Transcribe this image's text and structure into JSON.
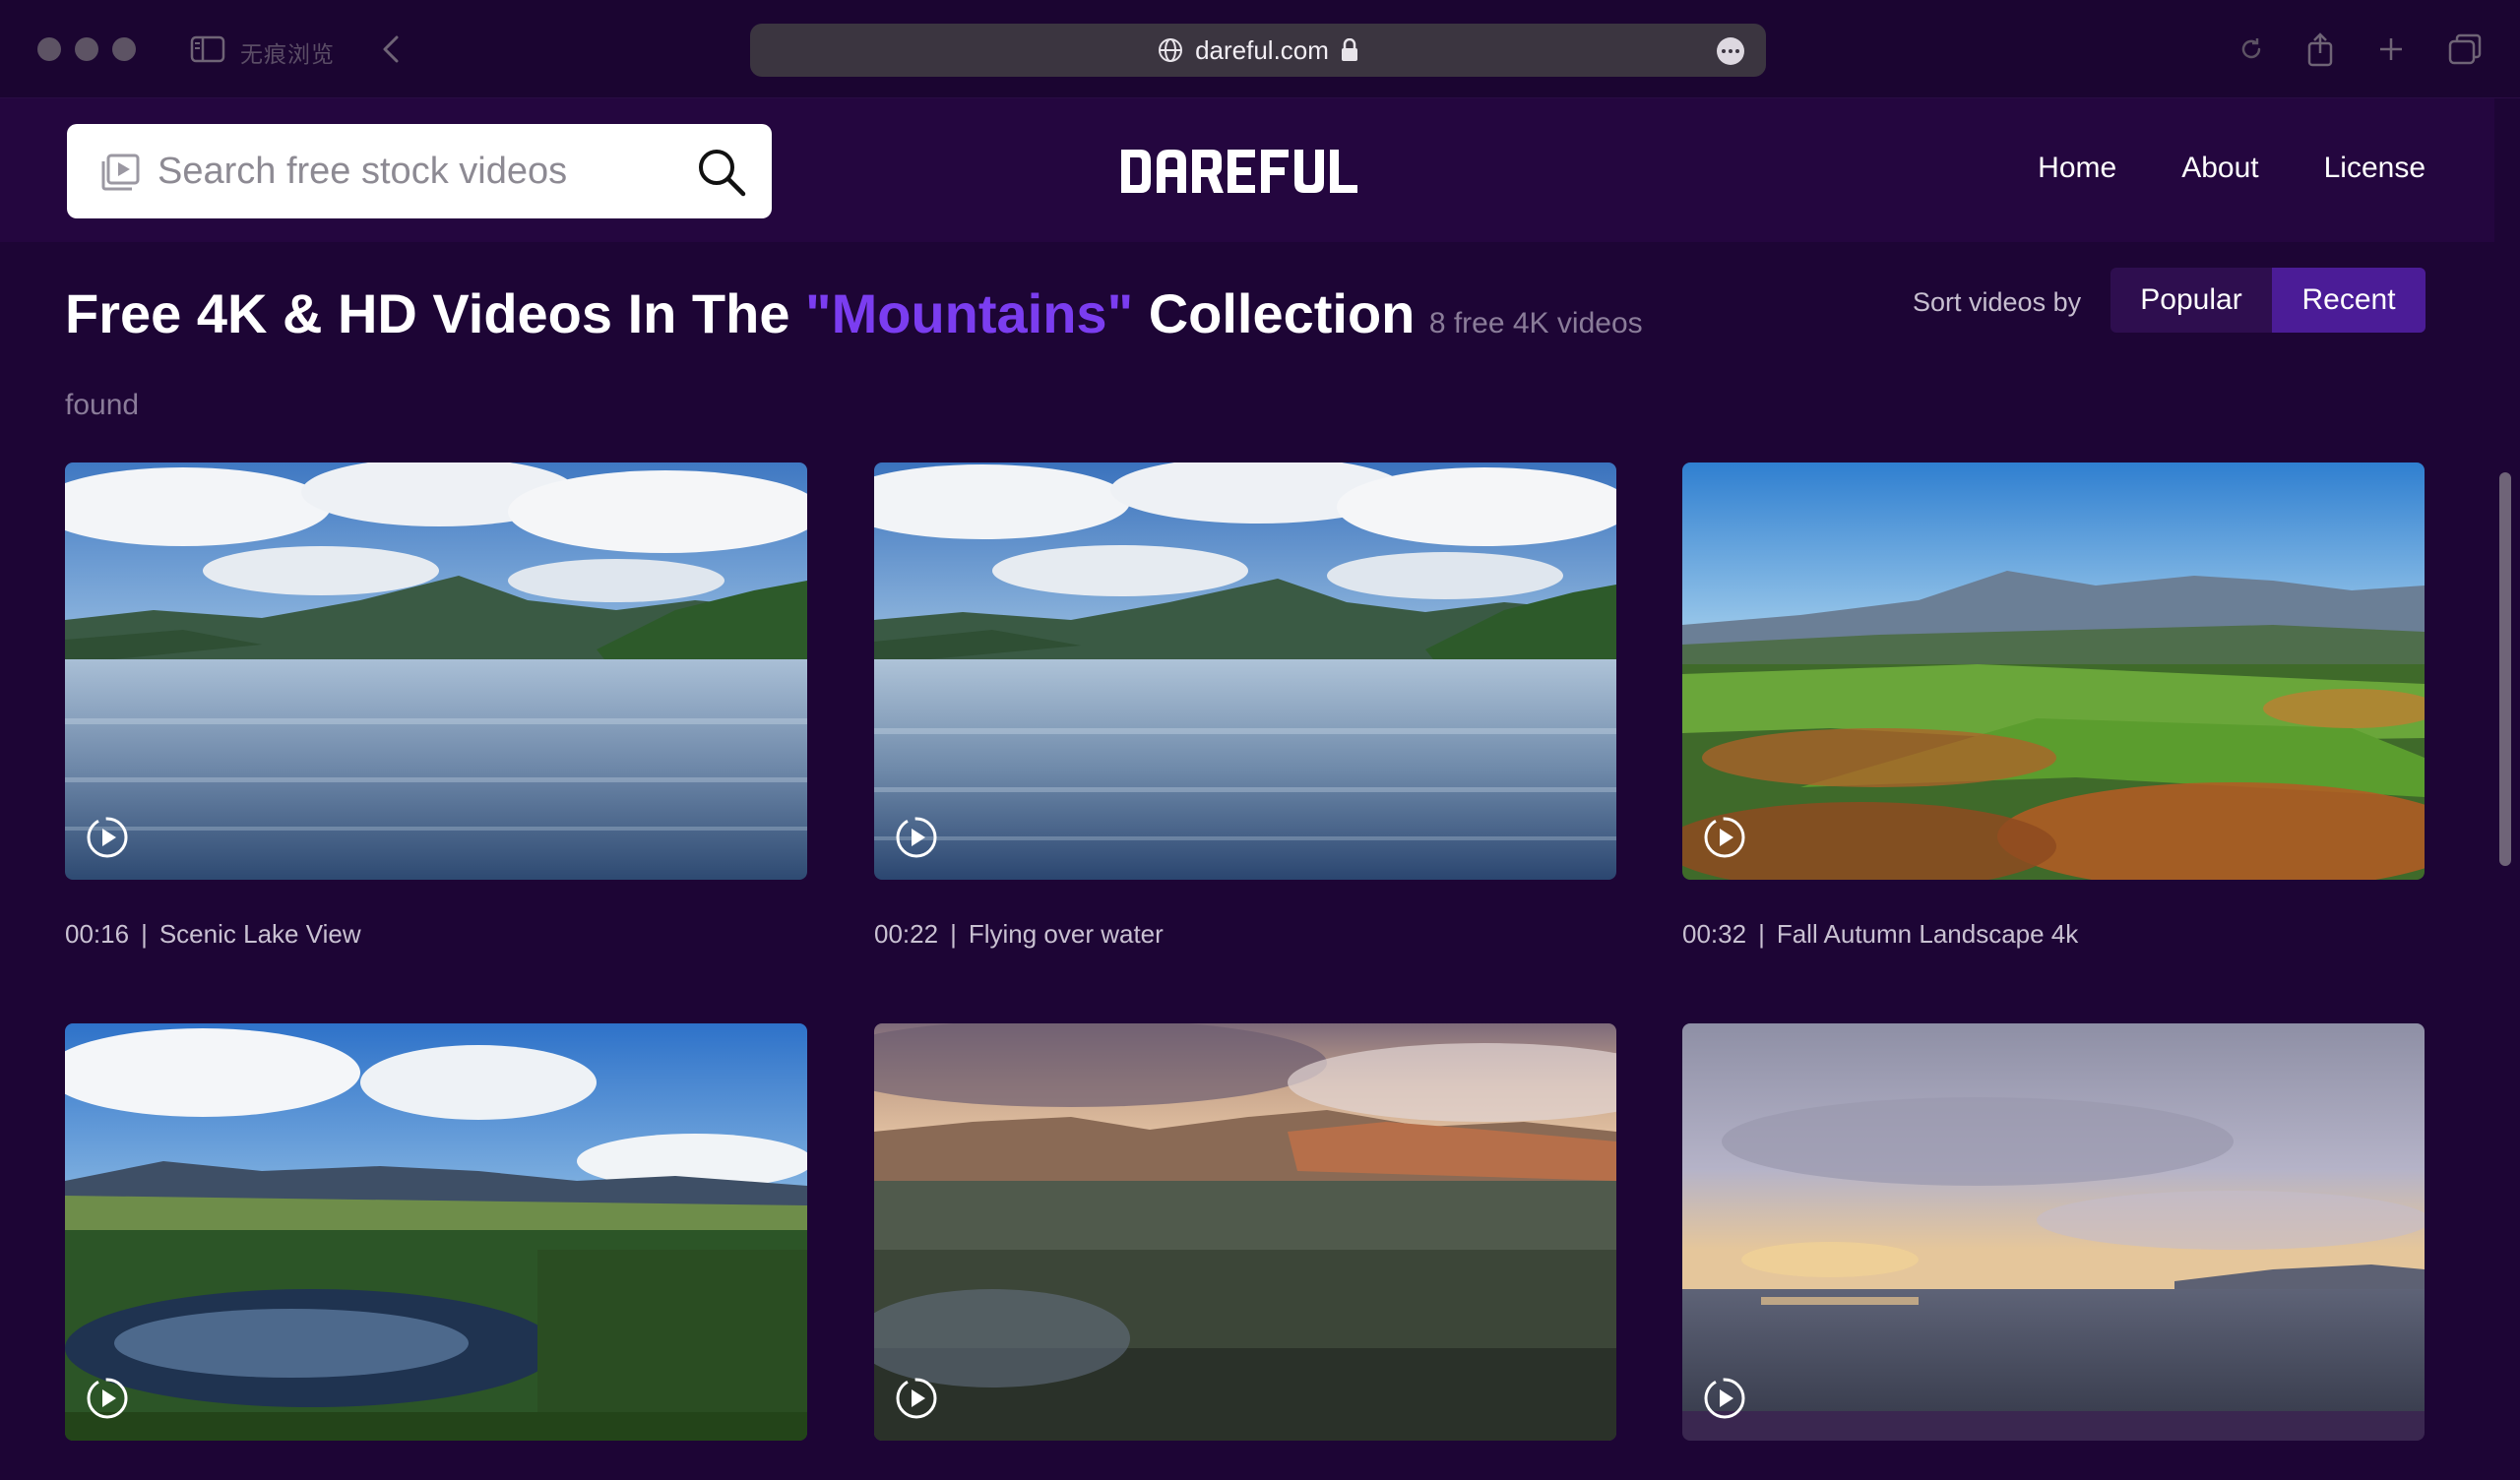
{
  "browser": {
    "private_label": "无痕浏览",
    "url": "dareful.com"
  },
  "header": {
    "search_placeholder": "Search free stock videos",
    "logo_text": "DAREFUL",
    "nav": [
      "Home",
      "About",
      "License"
    ]
  },
  "collection": {
    "title_prefix": "Free 4K & HD Videos In The",
    "title_highlight": "\"Mountains\"",
    "title_suffix": "Collection",
    "result_count": "8 free 4K videos found",
    "sort_label": "Sort videos by",
    "sort_options": [
      "Popular",
      "Recent"
    ],
    "sort_selected": "Recent"
  },
  "videos": [
    {
      "duration": "00:16",
      "title": "Scenic Lake View"
    },
    {
      "duration": "00:22",
      "title": "Flying over water"
    },
    {
      "duration": "00:32",
      "title": "Fall Autumn Landscape 4k"
    },
    {
      "duration": "",
      "title": ""
    },
    {
      "duration": "",
      "title": ""
    },
    {
      "duration": "",
      "title": ""
    }
  ],
  "colors": {
    "page_bg": "#1d0535",
    "header_bg": "#24063f",
    "accent": "#7b3df0",
    "sort_active": "#4b1c97"
  }
}
